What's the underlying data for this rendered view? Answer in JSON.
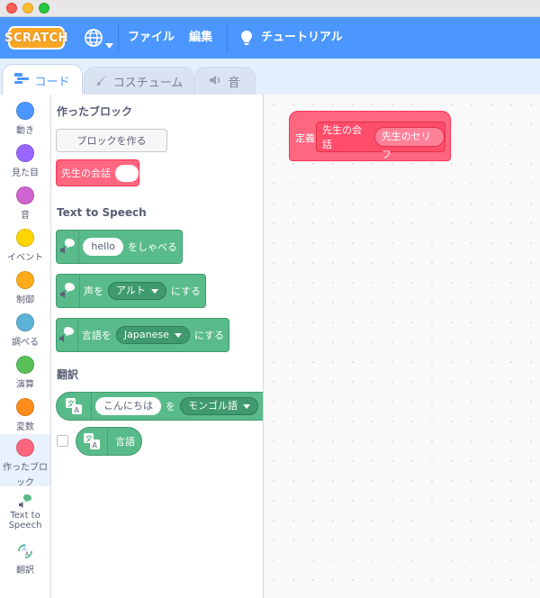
{
  "menu": {
    "logo": "SCRATCH",
    "file": "ファイル",
    "edit": "編集",
    "tutorials": "チュートリアル"
  },
  "tabs": [
    {
      "label": "コード",
      "icon": "code-icon"
    },
    {
      "label": "コスチューム",
      "icon": "brush-icon"
    },
    {
      "label": "音",
      "icon": "speaker-icon"
    }
  ],
  "categories": [
    {
      "label": "動き",
      "color": "#4c97ff"
    },
    {
      "label": "見た目",
      "color": "#9966ff"
    },
    {
      "label": "音",
      "color": "#cf63cf"
    },
    {
      "label": "イベント",
      "color": "#ffd500"
    },
    {
      "label": "制御",
      "color": "#ffab19"
    },
    {
      "label": "調べる",
      "color": "#5cb1d6"
    },
    {
      "label": "演算",
      "color": "#59c059"
    },
    {
      "label": "変数",
      "color": "#ff8c1a"
    },
    {
      "label1": "作ったブロ",
      "label2": "ック",
      "color": "#ff6680"
    },
    {
      "label1": "Text to",
      "label2": "Speech",
      "icon": "text-to-speech-icon"
    },
    {
      "label": "翻訳",
      "icon": "translate-icon"
    }
  ],
  "palette": {
    "my_blocks_title": "作ったブロック",
    "make_block_button": "ブロックを作る",
    "custom_block_label": "先生の会話",
    "tts_title": "Text to Speech",
    "speak_input": "hello",
    "speak_label": "をしゃべる",
    "voice_prefix": "声を",
    "voice_value": "アルト",
    "voice_suffix": "にする",
    "language_prefix": "言語を",
    "language_value": "Japanese",
    "language_suffix": "にする",
    "translate_title": "翻訳",
    "translate_input": "こんにちは",
    "translate_to": "を",
    "translate_language": "モンゴル語",
    "translate_suffix": "に",
    "language_reporter": "言語"
  },
  "script": {
    "define_label": "定義",
    "custom_block_label": "先生の会話",
    "param_label": "先生のセリフ"
  }
}
